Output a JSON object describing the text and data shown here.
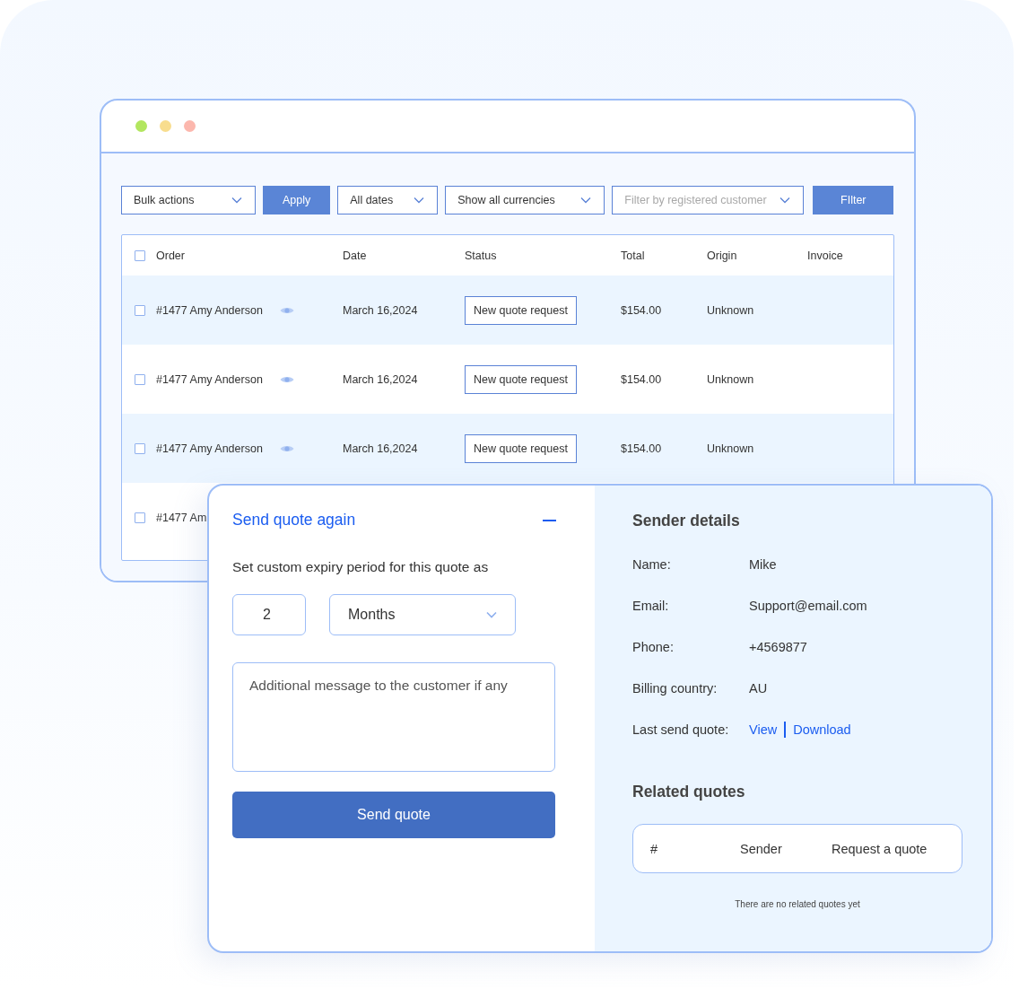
{
  "toolbar": [
    {
      "kind": "select",
      "value": "Bulk actions"
    },
    {
      "kind": "button",
      "label": "Apply"
    },
    {
      "kind": "select",
      "value": "All dates"
    },
    {
      "kind": "select",
      "value": "Show all currencies"
    },
    {
      "kind": "select",
      "placeholder": "Filter by registered customer"
    },
    {
      "kind": "button",
      "label": "FIlter"
    }
  ],
  "table": {
    "checked": false,
    "columns": [
      "Order",
      "Date",
      "Status",
      "Total",
      "Origin",
      "Invoice"
    ],
    "rows": [
      {
        "checked": false,
        "order": "#1477 Amy Anderson",
        "date": "March 16,2024",
        "status": "New quote request",
        "total": "$154.00",
        "origin": "Unknown"
      },
      {
        "checked": false,
        "order": "#1477 Amy Anderson",
        "date": "March 16,2024",
        "status": "New quote request",
        "total": "$154.00",
        "origin": "Unknown"
      },
      {
        "checked": false,
        "order": "#1477 Amy Anderson",
        "date": "March 16,2024",
        "status": "New quote request",
        "total": "$154.00",
        "origin": "Unknown"
      },
      {
        "checked": false,
        "order": "#1477 Am"
      }
    ]
  },
  "dialog": {
    "title": "Send quote again",
    "expanded": true,
    "expiry_label": "Set custom expiry period for this quote as",
    "expiry_value": "2",
    "expiry_unit": "Months",
    "message": {
      "placeholder": "Additional message to the customer if any"
    },
    "submit": "Send quote",
    "sender": {
      "title": "Sender details",
      "fields": [
        {
          "label": "Name:",
          "value": "Mike"
        },
        {
          "label": "Email:",
          "value": "Support@email.com"
        },
        {
          "label": "Phone:",
          "value": "+4569877"
        },
        {
          "label": "Billing country:",
          "value": "AU"
        }
      ],
      "last_quote": {
        "label": "Last send quote:",
        "links": [
          "View",
          "Download"
        ]
      }
    },
    "related": {
      "title": "Related quotes",
      "columns": [
        "#",
        "Sender",
        "Request a quote"
      ],
      "empty": "There are no related quotes yet"
    }
  }
}
